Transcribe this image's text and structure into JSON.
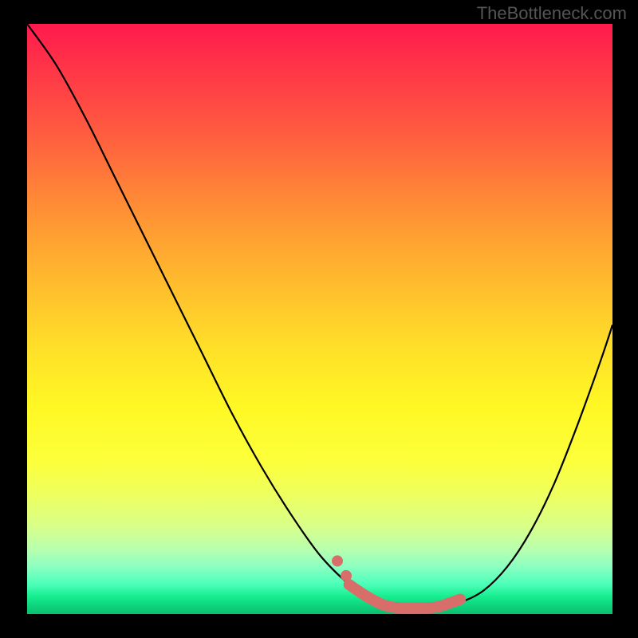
{
  "watermark": "TheBottleneck.com",
  "chart_data": {
    "type": "line",
    "title": "",
    "xlabel": "",
    "ylabel": "",
    "xlim": [
      0,
      100
    ],
    "ylim": [
      0,
      100
    ],
    "series": [
      {
        "name": "bottleneck-curve",
        "x": [
          0,
          5,
          10,
          15,
          20,
          25,
          30,
          35,
          40,
          45,
          50,
          55,
          58,
          61,
          64,
          67,
          70,
          74,
          78,
          82,
          86,
          90,
          94,
          98,
          100
        ],
        "y": [
          100,
          93,
          84,
          74,
          64,
          54,
          44,
          34,
          25,
          17,
          10,
          5,
          3,
          1.5,
          1,
          1,
          1.2,
          2,
          4,
          8,
          14,
          22,
          32,
          43,
          49
        ],
        "color": "#000000"
      },
      {
        "name": "optimal-zone-marker",
        "x": [
          55,
          58,
          61,
          64,
          67,
          70,
          72,
          74
        ],
        "y": [
          5,
          3,
          1.5,
          1,
          1,
          1.2,
          1.8,
          2.5
        ],
        "color": "#d86e6a"
      }
    ]
  }
}
